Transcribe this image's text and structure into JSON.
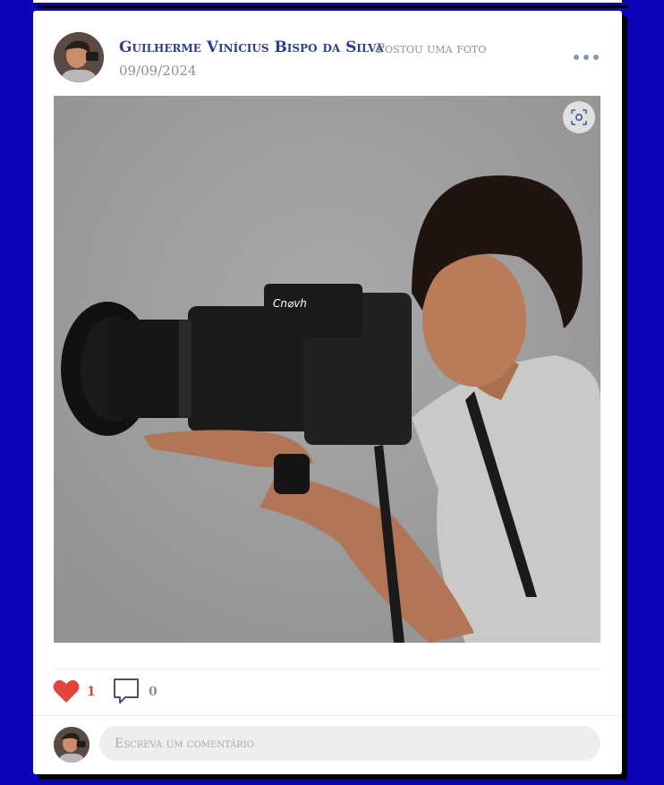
{
  "post": {
    "author": "Guilherme Vinícius Bispo da Silva",
    "action": "Postou uma foto",
    "date": "09/09/2024",
    "avatar": "avatar-image",
    "photo": "photographer-with-camera-image",
    "more_menu": "more-options-icon",
    "lens": "visual-search-icon"
  },
  "reactions": {
    "likes": "1",
    "comments": "0",
    "like_icon": "heart-icon",
    "comment_icon": "comment-bubble-icon",
    "like_color": "#e2453c"
  },
  "comment_box": {
    "placeholder": "Escreva um comentário"
  },
  "colors": {
    "background": "#0a03b8",
    "card": "#ffffff",
    "author": "#2a3f8f"
  }
}
